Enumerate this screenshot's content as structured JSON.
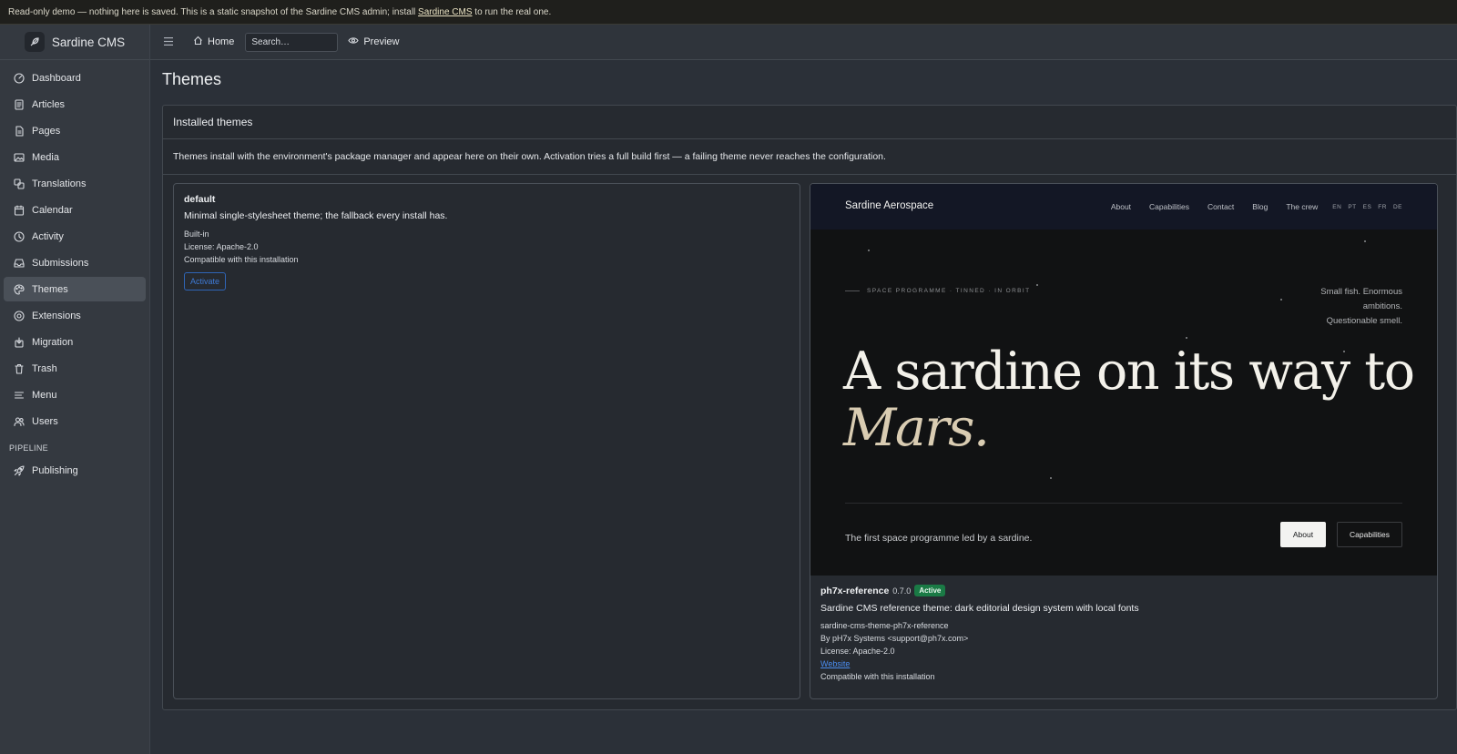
{
  "banner": {
    "text_before": "Read-only demo — nothing here is saved. This is a static snapshot of the Sardine CMS admin; install ",
    "link": "Sardine CMS",
    "text_after": " to run the real one."
  },
  "brand": {
    "name": "Sardine CMS"
  },
  "sidebar": {
    "items": [
      {
        "label": "Dashboard",
        "icon": "dashboard-icon"
      },
      {
        "label": "Articles",
        "icon": "article-icon"
      },
      {
        "label": "Pages",
        "icon": "page-icon"
      },
      {
        "label": "Media",
        "icon": "image-icon"
      },
      {
        "label": "Translations",
        "icon": "translate-icon"
      },
      {
        "label": "Calendar",
        "icon": "calendar-icon"
      },
      {
        "label": "Activity",
        "icon": "clock-icon"
      },
      {
        "label": "Submissions",
        "icon": "inbox-icon"
      },
      {
        "label": "Themes",
        "icon": "palette-icon",
        "active": true
      },
      {
        "label": "Extensions",
        "icon": "extension-icon"
      },
      {
        "label": "Migration",
        "icon": "migration-icon"
      },
      {
        "label": "Trash",
        "icon": "trash-icon"
      },
      {
        "label": "Menu",
        "icon": "menu-icon"
      },
      {
        "label": "Users",
        "icon": "users-icon"
      }
    ],
    "section_label": "PIPELINE",
    "pipeline_items": [
      {
        "label": "Publishing",
        "icon": "rocket-icon"
      }
    ]
  },
  "topbar": {
    "home_label": "Home",
    "search_placeholder": "Search…",
    "preview_label": "Preview"
  },
  "page": {
    "title": "Themes",
    "panel_title": "Installed themes",
    "description": "Themes install with the environment's package manager and appear here on their own. Activation tries a full build first — a failing theme never reaches the configuration."
  },
  "themes": {
    "default": {
      "name": "default",
      "description": "Minimal single-stylesheet theme; the fallback every install has.",
      "source": "Built-in",
      "license": "License: Apache-2.0",
      "compat": "Compatible with this installation",
      "activate_label": "Activate"
    },
    "reference": {
      "name": "ph7x-reference",
      "version": "0.7.0",
      "badge": "Active",
      "description": "Sardine CMS reference theme: dark editorial design system with local fonts",
      "package": "sardine-cms-theme-ph7x-reference",
      "author": "By pH7x Systems <support@ph7x.com>",
      "license": "License: Apache-2.0",
      "website": "Website",
      "compat": "Compatible with this installation",
      "preview": {
        "brand": "Sardine Aerospace",
        "nav_links": [
          "About",
          "Capabilities",
          "Contact",
          "Blog",
          "The crew"
        ],
        "langs": [
          "EN",
          "PT",
          "ES",
          "FR",
          "DE"
        ],
        "eyebrow": "SPACE PROGRAMME · TINNED · IN ORBIT",
        "tagline": [
          "Small fish. Enormous",
          "ambitions.",
          "Questionable smell."
        ],
        "headline": "A sardine on its way to",
        "headline_accent": "Mars.",
        "lede": "The first space programme led by a sardine.",
        "btn_primary": "About",
        "btn_secondary": "Capabilities"
      }
    }
  }
}
